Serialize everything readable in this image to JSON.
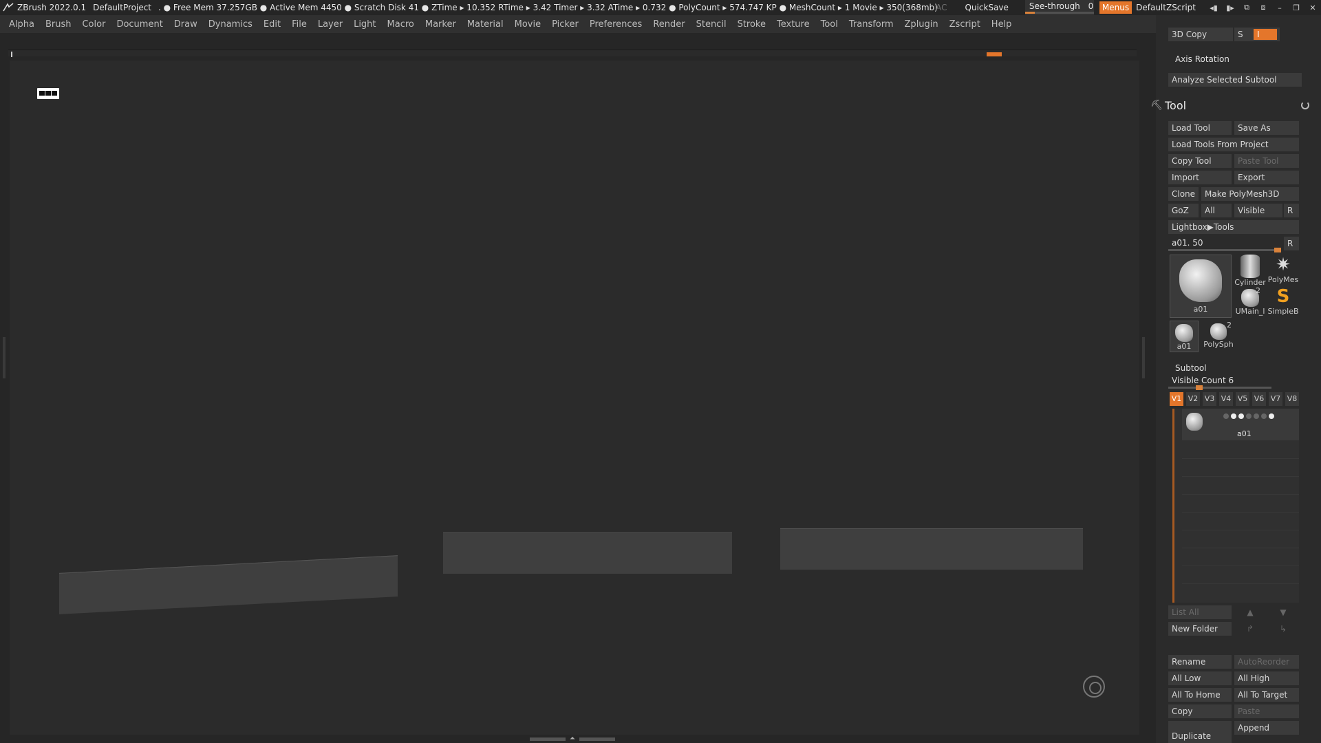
{
  "titlebar": {
    "app": "ZBrush 2022.0.1",
    "project": "DefaultProject",
    "stats": ". ● Free Mem 37.257GB ● Active Mem 4450 ● Scratch Disk 41 ●  ZTime ▸ 10.352 RTime ▸ 3.42 Timer ▸ 3.32 ATime ▸ 0.732 ● PolyCount ▸ 574.747 KP  ● MeshCount ▸ 1  Movie ▸ 350(368mb)",
    "ac": "AC",
    "quicksave": "QuickSave",
    "see_through_label": "See-through",
    "see_through_value": "0",
    "menus": "Menus",
    "script": "DefaultZScript"
  },
  "menubar": [
    "Alpha",
    "Brush",
    "Color",
    "Document",
    "Draw",
    "Dynamics",
    "Edit",
    "File",
    "Layer",
    "Light",
    "Macro",
    "Marker",
    "Material",
    "Movie",
    "Picker",
    "Preferences",
    "Render",
    "Stencil",
    "Stroke",
    "Texture",
    "Tool",
    "Transform",
    "Zplugin",
    "Zscript",
    "Help"
  ],
  "rpanel": {
    "copy3d": "3D Copy",
    "copy3d_s": "S",
    "copy3d_i": "I",
    "axis_rotation": "Axis Rotation",
    "analyze": "Analyze Selected Subtool",
    "tool_title": "Tool",
    "load_tool": "Load Tool",
    "save_as": "Save As",
    "load_from_project": "Load Tools From Project",
    "copy_tool": "Copy Tool",
    "paste_tool": "Paste Tool",
    "import": "Import",
    "export": "Export",
    "clone": "Clone",
    "make_polymesh": "Make PolyMesh3D",
    "goz": "GoZ",
    "all": "All",
    "visible": "Visible",
    "r": "R",
    "lightbox_tools": "Lightbox▶Tools",
    "current_tool": "a01. 50",
    "thumbs": {
      "main": "a01",
      "cylinder": "Cylinder",
      "polymesh": "PolyMes",
      "umain": "UMain_l",
      "simpleb": "SimpleB",
      "small_a01": "a01",
      "polysph": "PolySph",
      "umain_badge": "2",
      "polysph_badge": "2"
    },
    "subtool_title": "Subtool",
    "visible_count": "Visible Count 6",
    "vtabs": [
      "V1",
      "V2",
      "V3",
      "V4",
      "V5",
      "V6",
      "V7",
      "V8"
    ],
    "subtool_item": "a01",
    "list_all": "List All",
    "new_folder": "New Folder",
    "rename": "Rename",
    "auto_reorder": "AutoReorder",
    "all_low": "All Low",
    "all_high": "All High",
    "all_to_home": "All To Home",
    "all_to_target": "All To Target",
    "copy": "Copy",
    "paste": "Paste",
    "duplicate": "Duplicate",
    "append": "Append"
  },
  "colors": {
    "accent": "#e4762b",
    "panel": "#2b2b2b",
    "button": "#3b3b3b",
    "viewport": "#2b2b2b"
  }
}
